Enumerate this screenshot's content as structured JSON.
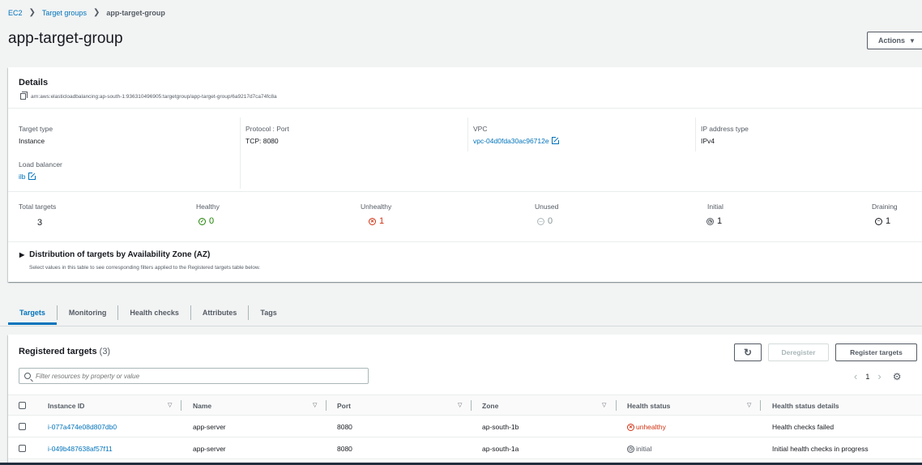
{
  "breadcrumb": {
    "root": "EC2",
    "parent": "Target groups",
    "current": "app-target-group"
  },
  "title": "app-target-group",
  "actions_label": "Actions",
  "details": {
    "heading": "Details",
    "arn": "arn:aws:elasticloadbalancing:ap-south-1:936310496905:targetgroup/app-target-group/6a9217d7ca74fc8a",
    "target_type": {
      "label": "Target type",
      "value": "Instance"
    },
    "protocol": {
      "label": "Protocol : Port",
      "value": "TCP: 8080"
    },
    "vpc": {
      "label": "VPC",
      "value": "vpc-04d0fda30ac96712e"
    },
    "ip_type": {
      "label": "IP address type",
      "value": "IPv4"
    },
    "load_balancer": {
      "label": "Load balancer",
      "value": "ilb"
    }
  },
  "stats": {
    "total": {
      "label": "Total targets",
      "value": "3"
    },
    "healthy": {
      "label": "Healthy",
      "value": "0"
    },
    "unhealthy": {
      "label": "Unhealthy",
      "value": "1"
    },
    "unused": {
      "label": "Unused",
      "value": "0"
    },
    "initial": {
      "label": "Initial",
      "value": "1"
    },
    "draining": {
      "label": "Draining",
      "value": "1"
    }
  },
  "az": {
    "title": "Distribution of targets by Availability Zone (AZ)",
    "description": "Select values in this table to see corresponding filters applied to the Registered targets table below."
  },
  "tabs": [
    "Targets",
    "Monitoring",
    "Health checks",
    "Attributes",
    "Tags"
  ],
  "registered": {
    "heading": "Registered targets",
    "count": "(3)",
    "deregister_label": "Deregister",
    "register_label": "Register targets",
    "search_placeholder": "Filter resources by property or value",
    "page": "1",
    "columns": [
      "Instance ID",
      "Name",
      "Port",
      "Zone",
      "Health status",
      "Health status details"
    ],
    "rows": [
      {
        "instance_id": "i-077a474e08d807db0",
        "name": "app-server",
        "port": "8080",
        "zone": "ap-south-1b",
        "status": "unhealthy",
        "details": "Health checks failed"
      },
      {
        "instance_id": "i-049b487638af57f11",
        "name": "app-server",
        "port": "8080",
        "zone": "ap-south-1a",
        "status": "initial",
        "details": "Initial health checks in progress"
      }
    ]
  },
  "colors": {
    "link": "#0073bb",
    "error": "#d13212",
    "success": "#1d8102"
  }
}
